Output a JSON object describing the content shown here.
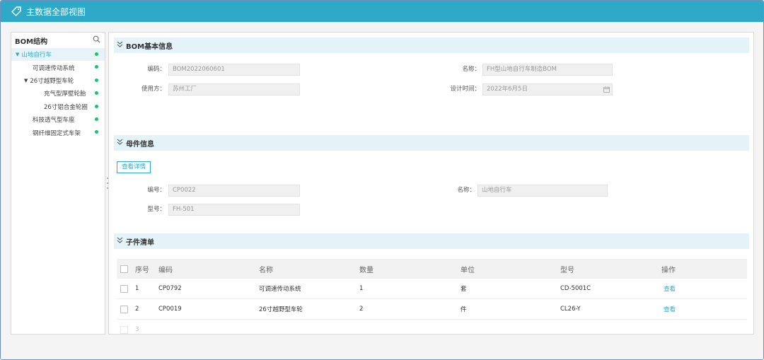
{
  "window": {
    "title": "主数据全部视图"
  },
  "sidebar": {
    "title": "BOM结构",
    "items": [
      {
        "label": "山地自行车",
        "level": 0,
        "expanded": true,
        "selected": true
      },
      {
        "label": "可调速传动系统",
        "level": 1
      },
      {
        "label": "26寸越野型车轮",
        "level": 1,
        "expanded": true
      },
      {
        "label": "充气型厚壁轮胎",
        "level": 2
      },
      {
        "label": "26寸铝合金轮圈",
        "level": 2
      },
      {
        "label": "科技透气型车座",
        "level": 1
      },
      {
        "label": "钢纤维固定式车架",
        "level": 1
      }
    ]
  },
  "bom_info": {
    "section_title": "BOM基本信息",
    "code_label": "编码：",
    "code_value": "BOM2022060601",
    "name_label": "名称：",
    "name_value": "FH型山地自行车制造BOM",
    "user_label": "使用方：",
    "user_value": "苏州工厂",
    "design_time_label": "设计时间：",
    "design_time_value": "2022年6月5日"
  },
  "parent_info": {
    "section_title": "母件信息",
    "view_detail": "查看详情",
    "code_label": "编号：",
    "code_value": "CP0022",
    "name_label": "名称：",
    "name_value": "山地自行车",
    "model_label": "型号：",
    "model_value": "FH-501"
  },
  "children": {
    "section_title": "子件清单",
    "columns": [
      "序号",
      "编码",
      "名称",
      "数量",
      "单位",
      "型号",
      "操作"
    ],
    "rows": [
      {
        "index": "1",
        "code": "CP0792",
        "name": "可调速传动系统",
        "qty": "1",
        "unit": "套",
        "model": "CD-5001C",
        "action": "查看"
      },
      {
        "index": "2",
        "code": "CP0019",
        "name": "26寸越野型车轮",
        "qty": "2",
        "unit": "件",
        "model": "CL26-Y",
        "action": "查看"
      },
      {
        "index": "3",
        "code": "",
        "name": "",
        "qty": "",
        "unit": "",
        "model": "",
        "action": ""
      }
    ]
  },
  "colors": {
    "titlebar": "#2fa9c8",
    "accent": "#2fa9c8",
    "status_dot": "#19c36b",
    "section_bg": "#e3f3f8"
  }
}
